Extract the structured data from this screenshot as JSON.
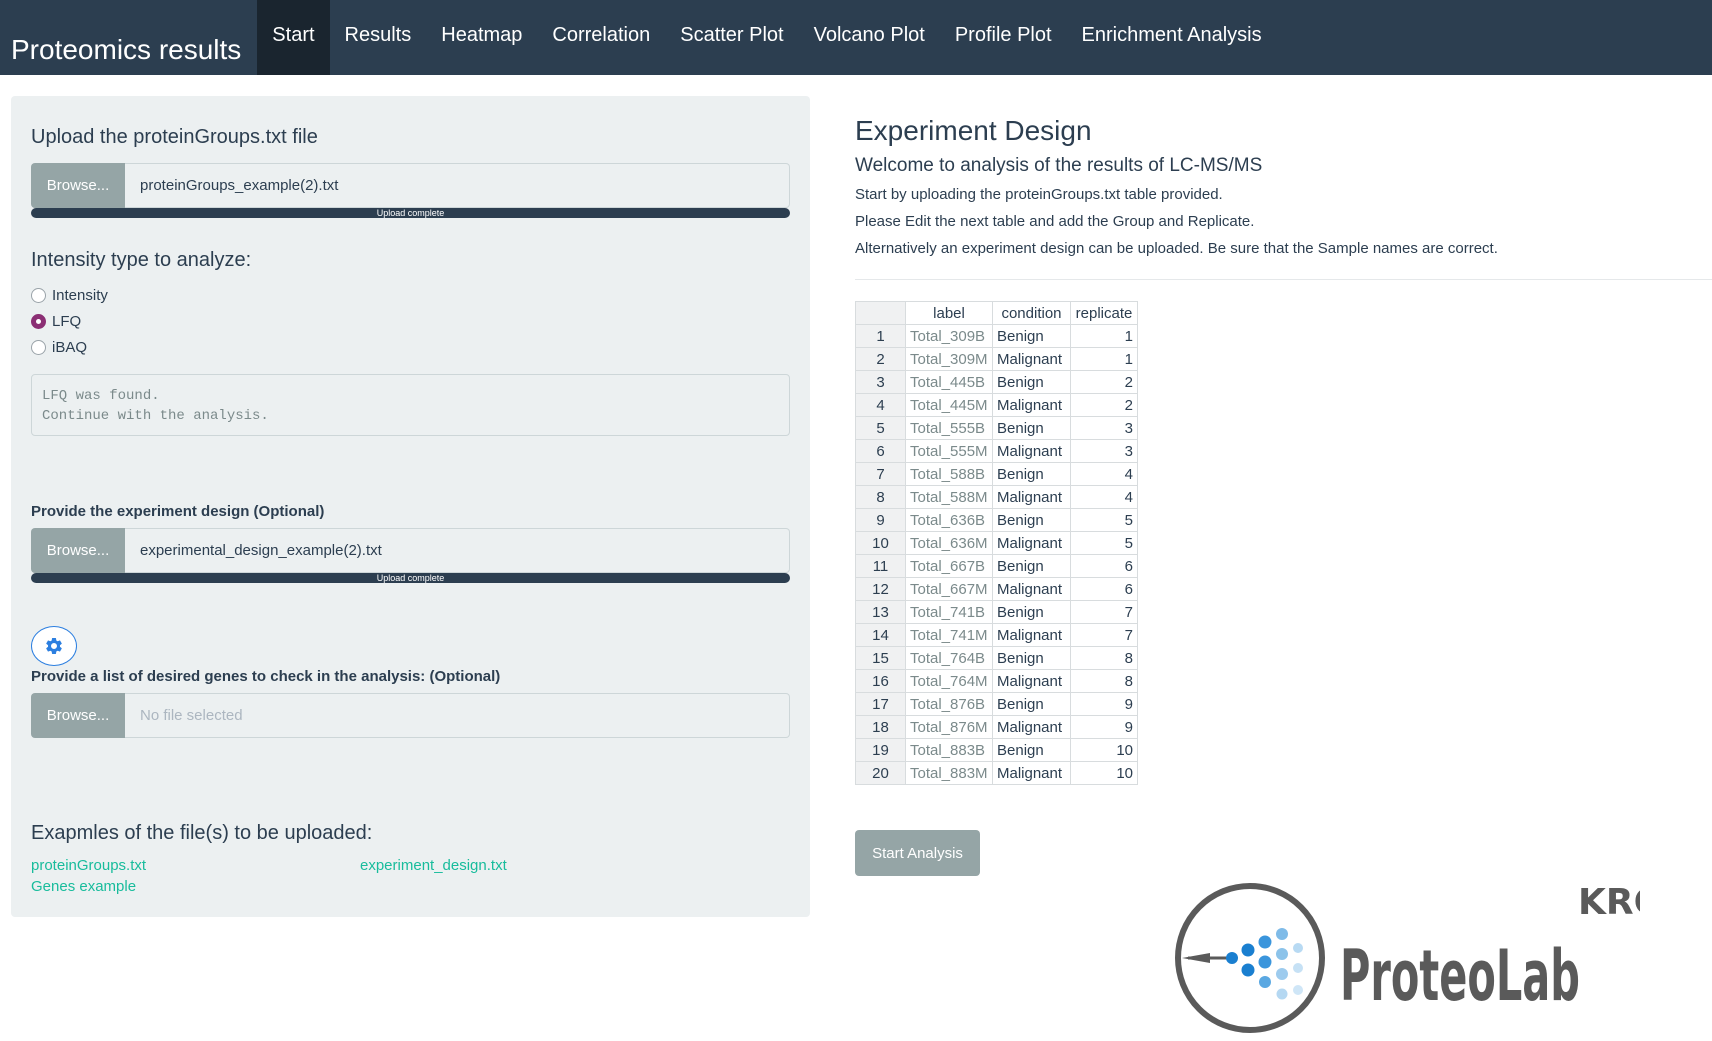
{
  "navbar": {
    "brand": "Proteomics results",
    "tabs": [
      {
        "label": "Start",
        "active": true
      },
      {
        "label": "Results"
      },
      {
        "label": "Heatmap"
      },
      {
        "label": "Correlation"
      },
      {
        "label": "Scatter Plot"
      },
      {
        "label": "Volcano Plot"
      },
      {
        "label": "Profile Plot"
      },
      {
        "label": "Enrichment Analysis"
      }
    ]
  },
  "sidebar": {
    "upload_title": "Upload the proteinGroups.txt file",
    "upload_browse": "Browse...",
    "upload_file": "proteinGroups_example(2).txt",
    "upload_progress": "Upload complete",
    "upload_progress_pct": 100,
    "intensity_title": "Intensity type to analyze:",
    "intensity_options": [
      {
        "label": "Intensity",
        "checked": false
      },
      {
        "label": "LFQ",
        "checked": true
      },
      {
        "label": "iBAQ",
        "checked": false
      }
    ],
    "status_lines": [
      "LFQ was found.",
      "Continue with the analysis."
    ],
    "design_title": "Provide the experiment design (Optional)",
    "design_browse": "Browse...",
    "design_file": "experimental_design_example(2).txt",
    "design_progress": "Upload complete",
    "design_progress_pct": 100,
    "settings_icon": "gear-icon",
    "genes_title": "Provide a list of desired genes to check in the analysis: (Optional)",
    "genes_browse": "Browse...",
    "genes_placeholder": "No file selected",
    "examples_title": "Exapmles of the file(s) to be uploaded:",
    "example_links": {
      "protein_groups": "proteinGroups.txt",
      "experiment_design": "experiment_design.txt",
      "genes": "Genes example"
    }
  },
  "main": {
    "title": "Experiment Design",
    "subtitle": "Welcome to analysis of the results of LC-MS/MS",
    "paragraphs": [
      "Start by uploading the proteinGroups.txt table provided.",
      "Please Edit the next table and add the Group and Replicate.",
      "Alternatively an experiment design can be uploaded. Be sure that the Sample names are correct."
    ],
    "table": {
      "headers": [
        "",
        "label",
        "condition",
        "replicate"
      ],
      "rows": [
        [
          "1",
          "Total_309B",
          "Benign",
          "1"
        ],
        [
          "2",
          "Total_309M",
          "Malignant",
          "1"
        ],
        [
          "3",
          "Total_445B",
          "Benign",
          "2"
        ],
        [
          "4",
          "Total_445M",
          "Malignant",
          "2"
        ],
        [
          "5",
          "Total_555B",
          "Benign",
          "3"
        ],
        [
          "6",
          "Total_555M",
          "Malignant",
          "3"
        ],
        [
          "7",
          "Total_588B",
          "Benign",
          "4"
        ],
        [
          "8",
          "Total_588M",
          "Malignant",
          "4"
        ],
        [
          "9",
          "Total_636B",
          "Benign",
          "5"
        ],
        [
          "10",
          "Total_636M",
          "Malignant",
          "5"
        ],
        [
          "11",
          "Total_667B",
          "Benign",
          "6"
        ],
        [
          "12",
          "Total_667M",
          "Malignant",
          "6"
        ],
        [
          "13",
          "Total_741B",
          "Benign",
          "7"
        ],
        [
          "14",
          "Total_741M",
          "Malignant",
          "7"
        ],
        [
          "15",
          "Total_764B",
          "Benign",
          "8"
        ],
        [
          "16",
          "Total_764M",
          "Malignant",
          "8"
        ],
        [
          "17",
          "Total_876B",
          "Benign",
          "9"
        ],
        [
          "18",
          "Total_876M",
          "Malignant",
          "9"
        ],
        [
          "19",
          "Total_883B",
          "Benign",
          "10"
        ],
        [
          "20",
          "Total_883M",
          "Malignant",
          "10"
        ]
      ]
    },
    "start_button": "Start Analysis",
    "logo": {
      "text": "ProteoLab",
      "superscript": "KRC"
    }
  },
  "colors": {
    "navbar": "#2c3e50",
    "navbar_active": "#1a252f",
    "sidebar_bg": "#ecf0f1",
    "button_grey": "#95a5a6",
    "link": "#18bc9c",
    "radio_checked": "#8b2f74",
    "logo_blue": "#1a7fd0",
    "logo_grey": "#5a5a5a"
  }
}
